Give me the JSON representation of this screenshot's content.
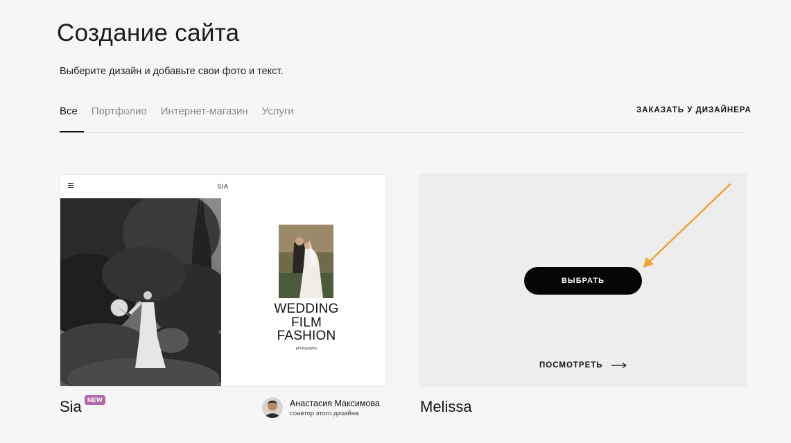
{
  "header": {
    "title": "Создание сайта",
    "subtitle": "Выберите дизайн и добавьте свои фото и текст."
  },
  "tabs": [
    {
      "label": "Все",
      "active": true
    },
    {
      "label": "Портфолио",
      "active": false
    },
    {
      "label": "Интернет-магазин",
      "active": false
    },
    {
      "label": "Услуги",
      "active": false
    }
  ],
  "order_designer_label": "ЗАКАЗАТЬ У ДИЗАЙНЕРА",
  "templates": [
    {
      "name": "Sia",
      "badge": "NEW",
      "preview": {
        "site_name": "SIA",
        "headline_lines": [
          "WEDDING",
          "FILM",
          "FASHION"
        ],
        "tagline": "photography"
      },
      "author": {
        "name": "Анастасия Максимова",
        "role": "соавтор этого дизайна"
      }
    },
    {
      "name": "Melissa",
      "select_label": "ВЫБРАТЬ",
      "view_label": "ПОСМОТРЕТЬ"
    }
  ],
  "colors": {
    "background": "#f6f6f6",
    "badge": "#b06aa8",
    "annotation_arrow": "#f0a035",
    "button": "#050505"
  }
}
